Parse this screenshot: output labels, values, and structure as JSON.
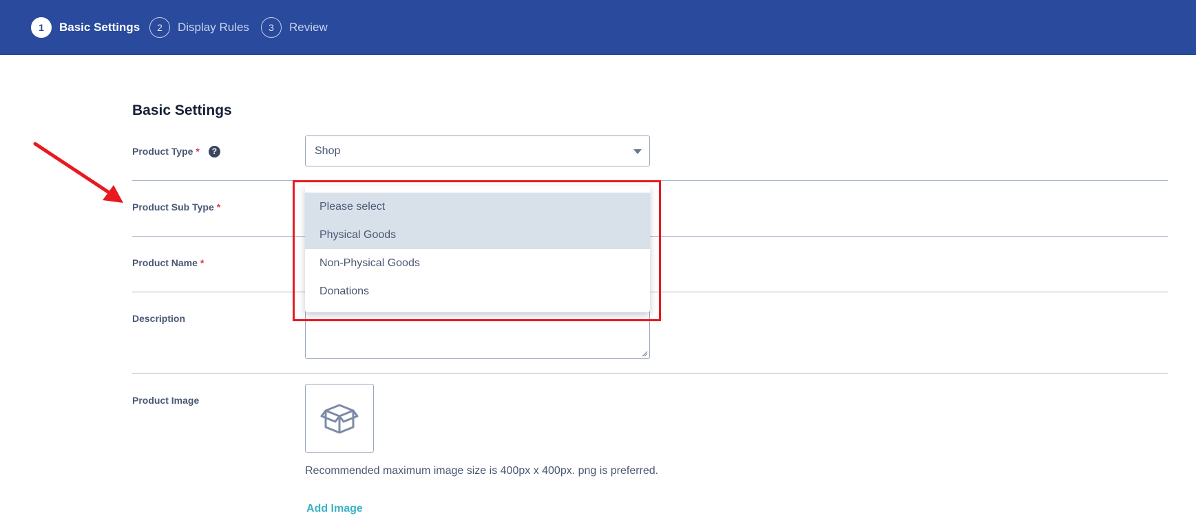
{
  "stepper": {
    "steps": [
      {
        "number": "1",
        "label": "Basic Settings",
        "active": true
      },
      {
        "number": "2",
        "label": "Display Rules",
        "active": false
      },
      {
        "number": "3",
        "label": "Review",
        "active": false
      }
    ]
  },
  "form": {
    "section_title": "Basic Settings",
    "product_type": {
      "label": "Product Type",
      "required_mark": "*",
      "help_icon": "question-circle-icon",
      "value": "Shop"
    },
    "product_sub_type": {
      "label": "Product Sub Type",
      "required_mark": "*"
    },
    "product_name": {
      "label": "Product Name",
      "required_mark": "*"
    },
    "description": {
      "label": "Description"
    },
    "product_image": {
      "label": "Product Image",
      "icon": "box-icon",
      "hint": "Recommended maximum image size is 400px x 400px. png is preferred.",
      "add_label": "Add Image"
    }
  },
  "dropdown": {
    "options": [
      "Please select",
      "Physical Goods",
      "Non-Physical Goods",
      "Donations"
    ],
    "highlighted": [
      "Please select",
      "Physical Goods"
    ]
  },
  "colors": {
    "header_bg": "#2a4a9e",
    "required": "#e0354a",
    "link": "#3bb3c3",
    "annotation": "#e8191f"
  }
}
